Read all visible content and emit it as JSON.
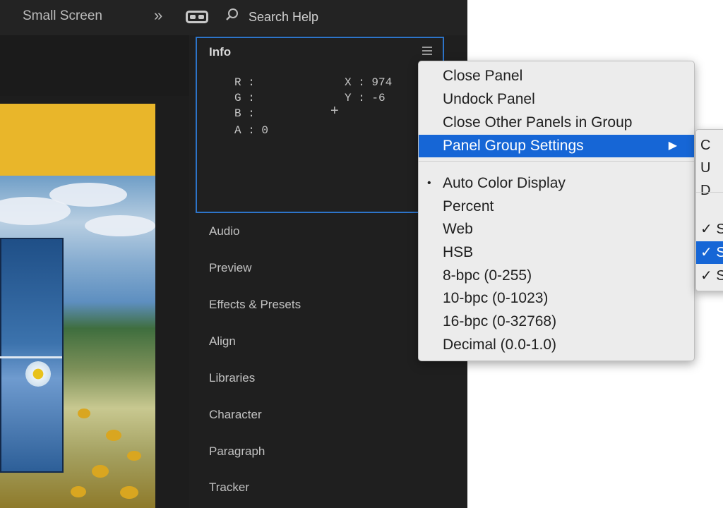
{
  "topbar": {
    "workspace_label": "Small Screen",
    "overflow_icon": "double-chevron-right-icon",
    "vr_icon": "vr-headset-icon",
    "search_icon": "search-icon",
    "search_placeholder": "Search Help"
  },
  "info_panel": {
    "title": "Info",
    "r_line": "R :",
    "g_line": "G :",
    "b_line": "B :",
    "a_line": "A : 0",
    "x_line": "X : 974",
    "y_line": "Y : -6",
    "crosshair_icon": "crosshair-icon",
    "menu_icon": "hamburger-menu-icon"
  },
  "panel_tabs": [
    "Audio",
    "Preview",
    "Effects & Presets",
    "Align",
    "Libraries",
    "Character",
    "Paragraph",
    "Tracker"
  ],
  "context_menu": {
    "items": [
      {
        "label": "Close Panel"
      },
      {
        "label": "Undock Panel"
      },
      {
        "label": "Close Other Panels in Group"
      },
      {
        "label": "Panel Group Settings",
        "submenu_icon": "triangle-right-icon"
      },
      {
        "label": "Auto Color Display",
        "bullet": "•"
      },
      {
        "label": "Percent"
      },
      {
        "label": "Web"
      },
      {
        "label": "HSB"
      },
      {
        "label": "8-bpc (0-255)"
      },
      {
        "label": "10-bpc (0-1023)"
      },
      {
        "label": "16-bpc (0-32768)"
      },
      {
        "label": "Decimal (0.0-1.0)"
      }
    ]
  },
  "submenu": {
    "items": [
      {
        "label": "C"
      },
      {
        "label": "U"
      },
      {
        "label": "D"
      },
      {
        "label": "✓ S"
      },
      {
        "label": "✓ S"
      },
      {
        "label": "✓ S"
      }
    ]
  },
  "colors": {
    "accent": "#1666d6",
    "panel_border": "#2d74c9",
    "dark_bg": "#1f1f1f",
    "comp_yellow": "#e9b62a"
  }
}
